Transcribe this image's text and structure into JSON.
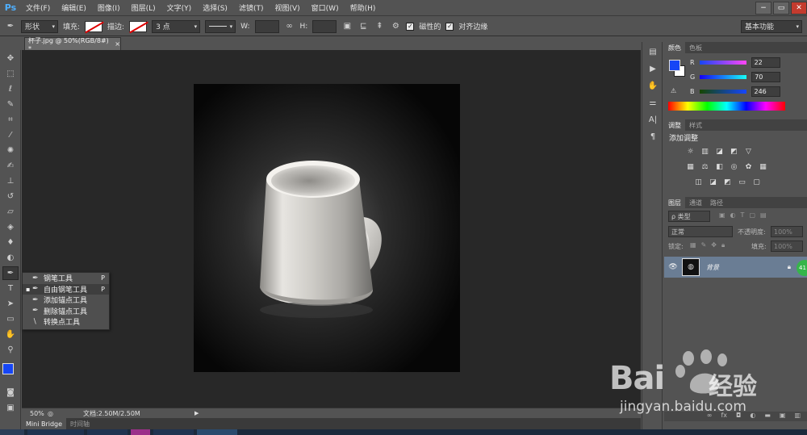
{
  "app": {
    "logo": "Ps",
    "menu": [
      "文件(F)",
      "编辑(E)",
      "图像(I)",
      "图层(L)",
      "文字(Y)",
      "选择(S)",
      "滤镜(T)",
      "视图(V)",
      "窗口(W)",
      "帮助(H)"
    ],
    "window_buttons": [
      "−",
      "▭",
      "✕"
    ]
  },
  "options": {
    "mode": "形状",
    "fill_label": "填充:",
    "stroke_label": "描边:",
    "stroke_size": "3 点",
    "w_label": "W:",
    "h_label": "H:",
    "magnetic_label": "磁性的",
    "align_edges_label": "对齐边缘",
    "workspace": "基本功能"
  },
  "document": {
    "tab_title": "杯子.jpg @ 50%(RGB/8#) *",
    "zoom": "50%",
    "doc_size": "文档:2.50M/2.50M"
  },
  "bottom_tabs": [
    "Mini Bridge",
    "时间轴"
  ],
  "flyout": {
    "items": [
      {
        "label": "钢笔工具",
        "key": "P",
        "selected": false
      },
      {
        "label": "自由钢笔工具",
        "key": "P",
        "selected": true
      },
      {
        "label": "添加锚点工具",
        "key": "",
        "selected": false
      },
      {
        "label": "删除锚点工具",
        "key": "",
        "selected": false
      },
      {
        "label": "转换点工具",
        "key": "",
        "selected": false
      }
    ]
  },
  "color_panel": {
    "tabs": [
      "颜色",
      "色板"
    ],
    "r_label": "R",
    "r": "22",
    "g_label": "G",
    "g": "70",
    "b_label": "B",
    "b": "246",
    "foreground": "#1646f6",
    "background": "#ffffff"
  },
  "adjust_panel": {
    "tabs": [
      "调整",
      "样式"
    ],
    "title": "添加调整"
  },
  "layers_panel": {
    "tabs": [
      "图层",
      "通道",
      "路径"
    ],
    "kind_label": "ρ 类型",
    "blend_mode": "正常",
    "opacity_label": "不透明度:",
    "opacity": "100%",
    "lock_label": "锁定:",
    "fill_label": "填充:",
    "fill": "100%",
    "layer_name": "背景",
    "badge": "41"
  },
  "watermark": {
    "brand": "Bai",
    "brand_suffix": "经验",
    "url": "jingyan.baidu.com"
  },
  "icons": {
    "tools": [
      "move-icon",
      "marquee-icon",
      "lasso-icon",
      "quick-select-icon",
      "crop-icon",
      "eyedropper-icon",
      "healing-icon",
      "brush-icon",
      "stamp-icon",
      "history-brush-icon",
      "eraser-icon",
      "bucket-icon",
      "blur-icon",
      "dodge-icon",
      "pen-icon",
      "type-icon",
      "path-select-icon",
      "rectangle-icon",
      "hand-icon",
      "zoom-icon"
    ]
  }
}
